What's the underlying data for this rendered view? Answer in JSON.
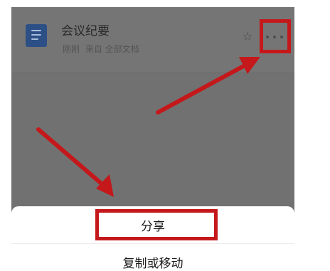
{
  "document": {
    "title": "会议纪要",
    "time": "刚刚",
    "source": "来自 全部文档",
    "icon": "document-icon",
    "star_icon": "star-outline-icon",
    "more_icon": "more-horizontal-icon"
  },
  "action_sheet": {
    "items": [
      {
        "label": "分享"
      },
      {
        "label": "复制或移动"
      }
    ]
  },
  "annotation": {
    "color": "#c4181b"
  }
}
